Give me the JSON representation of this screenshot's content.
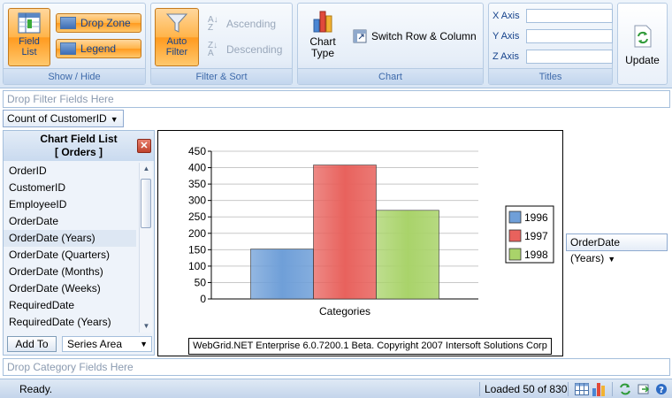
{
  "ribbon": {
    "show_hide": {
      "field_list_label_1": "Field",
      "field_list_label_2": "List",
      "drop_zone_label": "Drop Zone",
      "legend_label": "Legend",
      "group_label": "Show / Hide"
    },
    "filter_sort": {
      "auto_filter_label_1": "Auto",
      "auto_filter_label_2": "Filter",
      "ascending_label": "Ascending",
      "descending_label": "Descending",
      "group_label": "Filter & Sort"
    },
    "chart": {
      "chart_type_label_1": "Chart",
      "chart_type_label_2": "Type",
      "switch_label": "Switch Row & Column",
      "group_label": "Chart"
    },
    "titles": {
      "x_axis_label": "X Axis",
      "y_axis_label": "Y Axis",
      "z_axis_label": "Z Axis",
      "x_axis_value": "",
      "y_axis_value": "",
      "z_axis_value": "",
      "group_label": "Titles"
    },
    "update_label": "Update"
  },
  "filter_zone": {
    "placeholder": "Drop Filter Fields Here"
  },
  "data_field": {
    "label": "Count of CustomerID"
  },
  "field_panel": {
    "title": "Chart Field List",
    "subtitle": "[ Orders ]",
    "fields": [
      "OrderID",
      "CustomerID",
      "EmployeeID",
      "OrderDate",
      "OrderDate (Years)",
      "OrderDate (Quarters)",
      "OrderDate (Months)",
      "OrderDate (Weeks)",
      "RequiredDate",
      "RequiredDate (Years)"
    ],
    "selected_index": 4,
    "add_button": "Add To",
    "area_select": "Series Area"
  },
  "series_field": {
    "label": "OrderDate (Years)"
  },
  "category_zone": {
    "placeholder": "Drop Category Fields Here"
  },
  "copyright": "WebGrid.NET Enterprise 6.0.7200.1 Beta. Copyright 2007 Intersoft Solutions Corp",
  "chart_data": {
    "type": "bar",
    "categories": [
      "Categories"
    ],
    "series": [
      {
        "name": "1996",
        "values": [
          152
        ],
        "color": "#6f9fd8"
      },
      {
        "name": "1997",
        "values": [
          408
        ],
        "color": "#e8625d"
      },
      {
        "name": "1998",
        "values": [
          270
        ],
        "color": "#a9d36a"
      }
    ],
    "ylim": [
      0,
      450
    ],
    "yticks": [
      0,
      50,
      100,
      150,
      200,
      250,
      300,
      350,
      400,
      450
    ],
    "xlabel": "Categories",
    "ylabel": "",
    "title": "",
    "grid": true,
    "legend": "right"
  },
  "status": {
    "ready": "Ready.",
    "loaded": "Loaded 50 of 830"
  }
}
